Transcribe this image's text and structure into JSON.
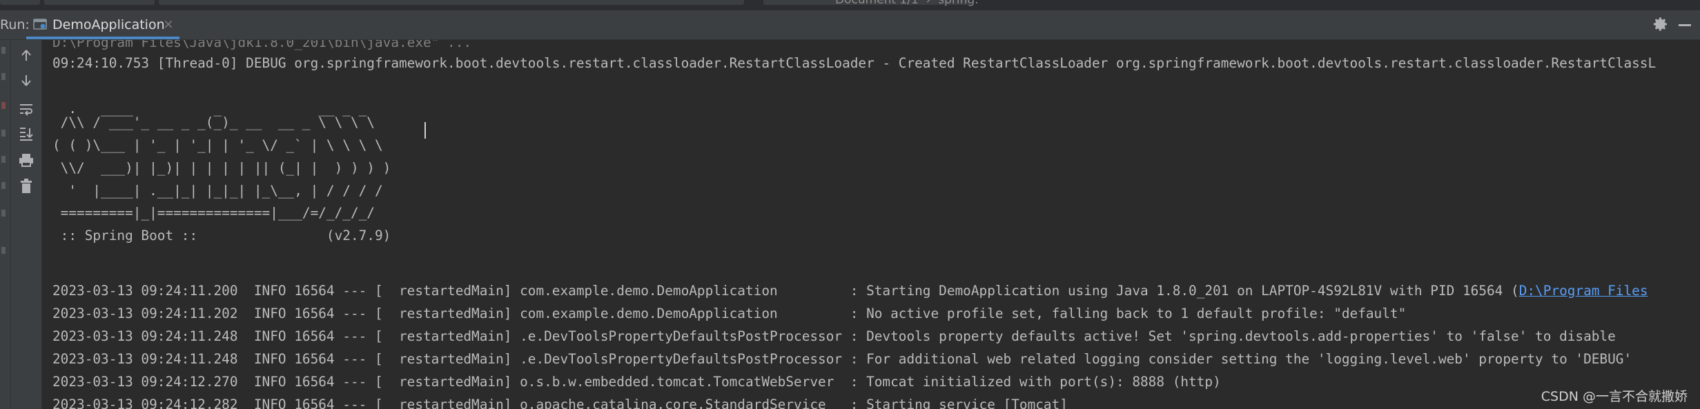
{
  "top_bar": {
    "document_title": "Document 1/1  ›  spring:"
  },
  "run_window": {
    "label": "Run:",
    "tab": {
      "label": "DemoApplication",
      "close_glyph": "×",
      "icon": "application-config-icon"
    },
    "header_icons": [
      "gear-icon",
      "minimize-icon"
    ]
  },
  "toolbar": {
    "buttons": [
      {
        "name": "up-arrow-icon"
      },
      {
        "name": "down-arrow-icon"
      },
      {
        "name": "soft-wrap-icon"
      },
      {
        "name": "scroll-to-end-icon"
      },
      {
        "name": "print-icon"
      },
      {
        "name": "trash-icon"
      }
    ]
  },
  "console": {
    "command_line": "D:\\Program Files\\Java\\jdk1.8.0_201\\bin\\java.exe\" ...",
    "debug_line": "09:24:10.753 [Thread-0] DEBUG org.springframework.boot.devtools.restart.classloader.RestartClassLoader - Created RestartClassLoader org.springframework.boot.devtools.restart.classloader.RestartClassL",
    "banner": [
      "  .   ____          _            __ _ _",
      " /\\\\ / ___'_ __ _ _(_)_ __  __ _ \\ \\ \\ \\",
      "( ( )\\___ | '_ | '_| | '_ \\/ _` | \\ \\ \\ \\",
      " \\\\/  ___)| |_)| | | | | || (_| |  ) ) ) )",
      "  '  |____| .__|_| |_|_| |_\\__, | / / / /",
      " =========|_|==============|___/=/_/_/_/",
      " :: Spring Boot ::                (v2.7.9)"
    ],
    "log_lines": [
      {
        "text": "2023-03-13 09:24:11.200  INFO 16564 --- [  restartedMain] com.example.demo.DemoApplication         : Starting DemoApplication using Java 1.8.0_201 on LAPTOP-4S92L81V with PID 16564 (",
        "link": "D:\\Program Files"
      },
      {
        "text": "2023-03-13 09:24:11.202  INFO 16564 --- [  restartedMain] com.example.demo.DemoApplication         : No active profile set, falling back to 1 default profile: \"default\"",
        "link": ""
      },
      {
        "text": "2023-03-13 09:24:11.248  INFO 16564 --- [  restartedMain] .e.DevToolsPropertyDefaultsPostProcessor : Devtools property defaults active! Set 'spring.devtools.add-properties' to 'false' to disable",
        "link": ""
      },
      {
        "text": "2023-03-13 09:24:11.248  INFO 16564 --- [  restartedMain] .e.DevToolsPropertyDefaultsPostProcessor : For additional web related logging consider setting the 'logging.level.web' property to 'DEBUG'",
        "link": ""
      },
      {
        "text": "2023-03-13 09:24:12.270  INFO 16564 --- [  restartedMain] o.s.b.w.embedded.tomcat.TomcatWebServer  : Tomcat initialized with port(s): 8888 (http)",
        "link": ""
      },
      {
        "text": "2023-03-13 09:24:12.282  INFO 16564 --- [  restartedMain] o.apache.catalina.core.StandardService   : Starting service [Tomcat]",
        "link": ""
      }
    ]
  },
  "watermark": "CSDN @一言不合就撒娇",
  "colors": {
    "console_bg": "#2b2b2b",
    "panel_bg": "#3c3f41",
    "text": "#bbbbbb",
    "link": "#589df6",
    "tab_underline": "#4a88c7"
  }
}
